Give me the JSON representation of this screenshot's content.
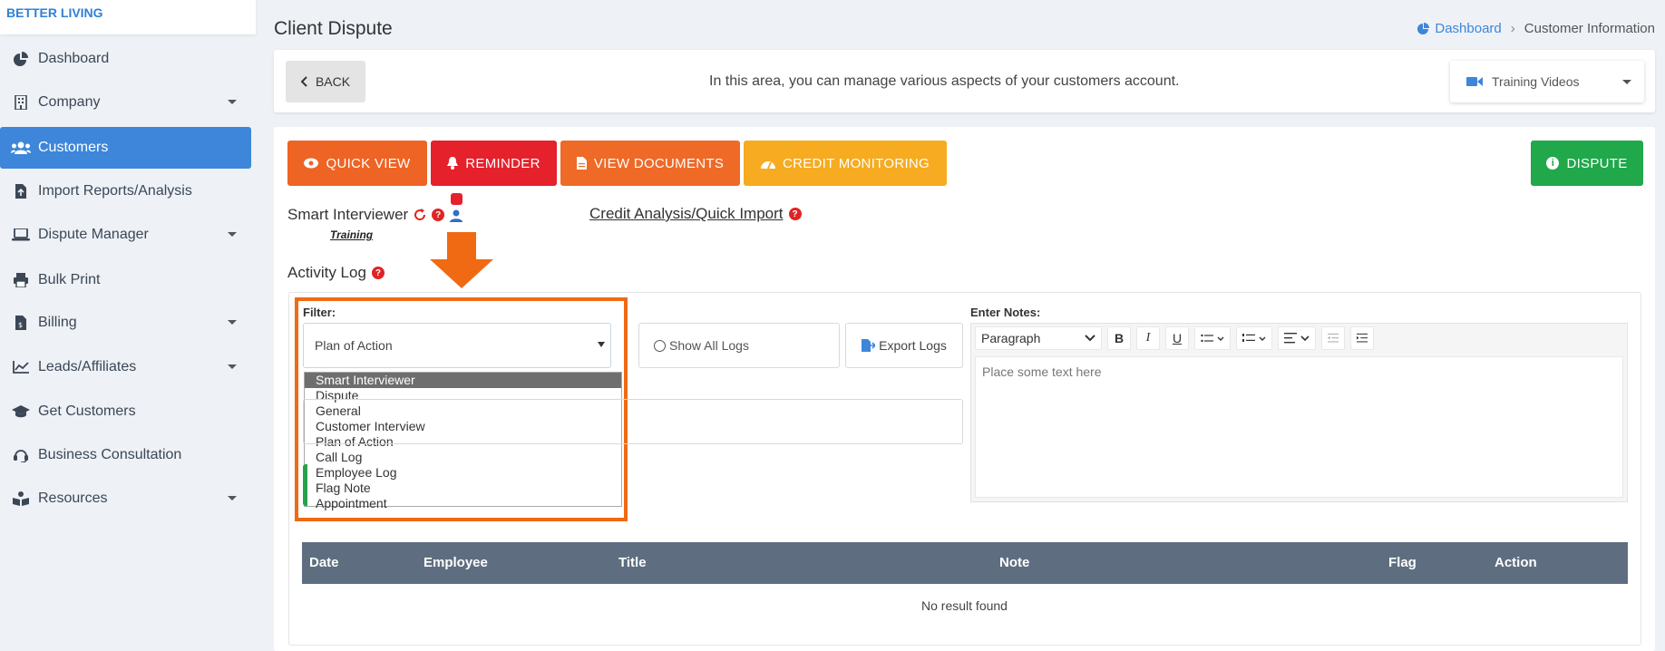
{
  "brand": "BETTER LIVING",
  "sidebar": {
    "items": [
      {
        "label": "Dashboard",
        "icon": "pie-chart-icon",
        "caret": false,
        "active": false
      },
      {
        "label": "Company",
        "icon": "building-icon",
        "caret": true,
        "active": false
      },
      {
        "label": "Customers",
        "icon": "users-icon",
        "caret": false,
        "active": true
      },
      {
        "label": "Import Reports/Analysis",
        "icon": "file-upload-icon",
        "caret": false,
        "active": false
      },
      {
        "label": "Dispute Manager",
        "icon": "laptop-icon",
        "caret": true,
        "active": false
      },
      {
        "label": "Bulk Print",
        "icon": "printer-icon",
        "caret": false,
        "active": false
      },
      {
        "label": "Billing",
        "icon": "invoice-icon",
        "caret": true,
        "active": false
      },
      {
        "label": "Leads/Affiliates",
        "icon": "chart-line-icon",
        "caret": true,
        "active": false
      },
      {
        "label": "Get Customers",
        "icon": "graduation-cap-icon",
        "caret": false,
        "active": false
      },
      {
        "label": "Business Consultation",
        "icon": "headset-icon",
        "caret": false,
        "active": false
      },
      {
        "label": "Resources",
        "icon": "book-reader-icon",
        "caret": true,
        "active": false
      }
    ]
  },
  "header": {
    "title": "Client Dispute",
    "breadcrumb": {
      "home": "Dashboard",
      "current": "Customer Information"
    }
  },
  "topbar": {
    "back_label": "BACK",
    "info": "In this area, you can manage various aspects of your customers account.",
    "videos_label": "Training Videos"
  },
  "actions": {
    "quick_view": "QUICK VIEW",
    "reminder": "REMINDER",
    "view_documents": "VIEW DOCUMENTS",
    "credit_monitoring": "CREDIT MONITORING",
    "dispute": "DISPUTE"
  },
  "colors": {
    "quick_view": "#ee6424",
    "reminder": "#e5212b",
    "view_documents": "#ef6a27",
    "credit_monitoring": "#f6ab20",
    "dispute": "#20a84a",
    "active_nav": "#3d86d9",
    "highlight": "#ef6a13"
  },
  "smart": {
    "label": "Smart Interviewer",
    "training": "Training",
    "credit_link": "Credit Analysis/Quick Import"
  },
  "activity": {
    "label": "Activity Log",
    "filter_label": "Filter:",
    "filter_value": "Plan of Action",
    "options": [
      "Smart Interviewer",
      "Dispute",
      "General",
      "Customer Interview",
      "Plan of Action",
      "Call Log",
      "Employee Log",
      "Flag Note",
      "Appointment"
    ],
    "show_all": "Show All Logs",
    "export": "Export Logs",
    "notes_label": "Enter Notes:",
    "paragraph": "Paragraph",
    "placeholder": "Place some text here"
  },
  "table": {
    "headers": [
      "Date",
      "Employee",
      "Title",
      "Note",
      "Flag",
      "Action"
    ],
    "empty": "No result found"
  }
}
